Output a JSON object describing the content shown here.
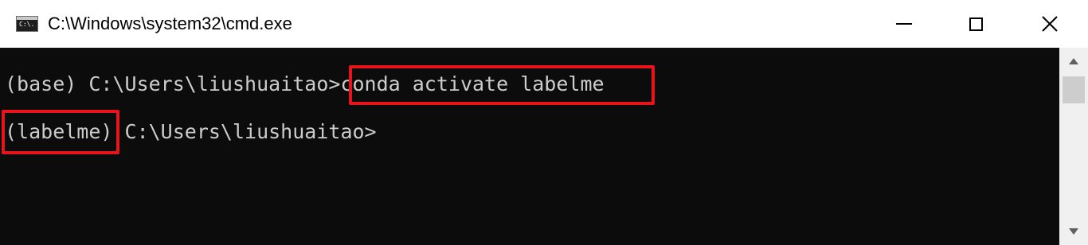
{
  "window": {
    "title": "C:\\Windows\\system32\\cmd.exe",
    "icon": "cmd-icon",
    "icon_text": "C:\\."
  },
  "titlebar_buttons": {
    "minimize": "minimize-icon",
    "maximize": "maximize-icon",
    "close": "close-icon"
  },
  "console": {
    "background": "#0c0c0c",
    "text_color": "#cccccc",
    "line1": {
      "prompt": "(base) C:\\Users\\liushuaitao>",
      "command": "conda activate labelme"
    },
    "line2": {
      "env": "(labelme)",
      "prompt": " C:\\Users\\liushuaitao>"
    }
  },
  "highlight_color": "#e8141c",
  "scrollbar": {
    "up_icon": "scroll-up-arrow-icon",
    "down_icon": "scroll-down-arrow-icon"
  }
}
